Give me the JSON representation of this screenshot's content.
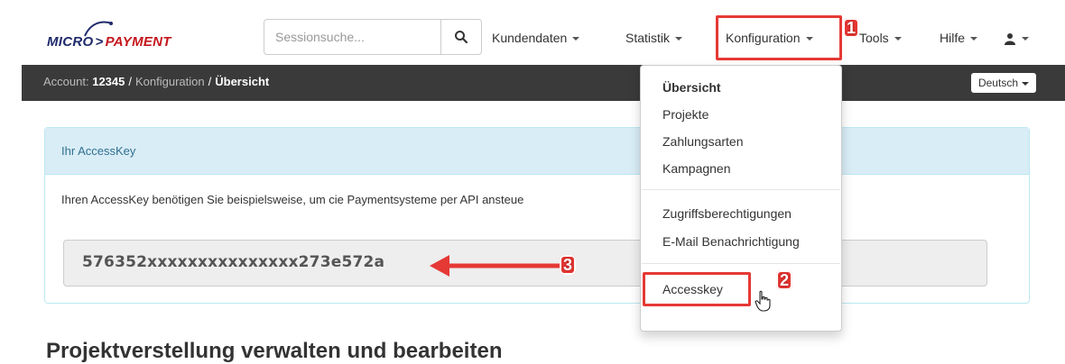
{
  "logo": {
    "part1": "MICRO",
    "part2": "PAYMENT"
  },
  "search": {
    "placeholder": "Sessionsuche..."
  },
  "nav": [
    {
      "label": "Kundendaten"
    },
    {
      "label": "Statistik"
    },
    {
      "label": "Konfiguration"
    },
    {
      "label": "Tools"
    },
    {
      "label": "Hilfe"
    }
  ],
  "breadcrumb": {
    "account_label": "Account:",
    "account_id": "12345",
    "section": "Konfiguration",
    "current": "Übersicht"
  },
  "language": "Deutsch",
  "panel": {
    "title": "Ihr AccessKey",
    "description": "Ihren AccessKey benötigen Sie beispielsweise, um cie Paymentsysteme per API ansteue",
    "key": "576352xxxxxxxxxxxxxxx273e572a"
  },
  "next_heading": "Projektverstellung verwalten und bearbeiten",
  "dropdown": {
    "items": [
      {
        "label": "Übersicht"
      },
      {
        "label": "Projekte"
      },
      {
        "label": "Zahlungsarten"
      },
      {
        "label": "Kampagnen"
      },
      {
        "label": "Zugriffsberechtigungen"
      },
      {
        "label": "E-Mail Benachrichtigung"
      },
      {
        "label": "Accesskey"
      }
    ]
  },
  "annotations": {
    "step1": "1",
    "step2": "2",
    "step3": "3"
  },
  "colors": {
    "highlight": "#e53935",
    "darkbar": "#3a3a3a",
    "panel_head": "#d9edf7"
  }
}
